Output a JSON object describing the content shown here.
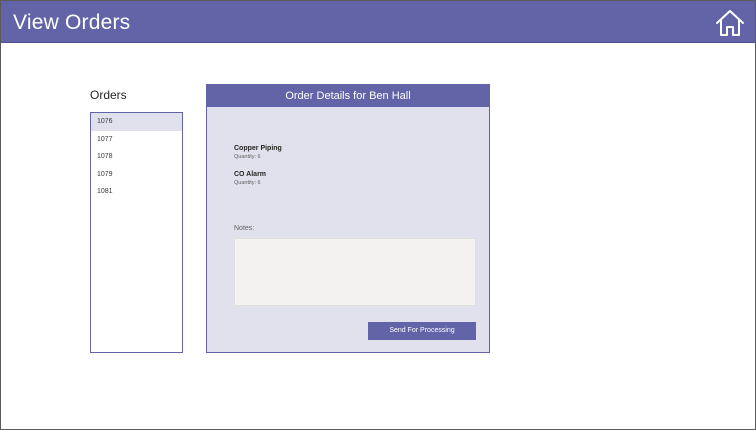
{
  "header": {
    "title": "View Orders",
    "icon": "home-icon"
  },
  "orders": {
    "label": "Orders",
    "items": [
      "1076",
      "1077",
      "1078",
      "1079",
      "1081"
    ],
    "selected": "1076"
  },
  "details": {
    "title": "Order Details for Ben Hall",
    "line_items": [
      {
        "name": "Copper Piping",
        "quantity": "Quantity: 6"
      },
      {
        "name": "CO Alarm",
        "quantity": "Quantity: 6"
      }
    ],
    "notes_label": "Notes:",
    "notes_value": "",
    "send_button_label": "Send For Processing"
  },
  "colors": {
    "accent": "#6264a7",
    "panel_bg": "#e1e1ee",
    "notes_bg": "#f3f2f1"
  }
}
